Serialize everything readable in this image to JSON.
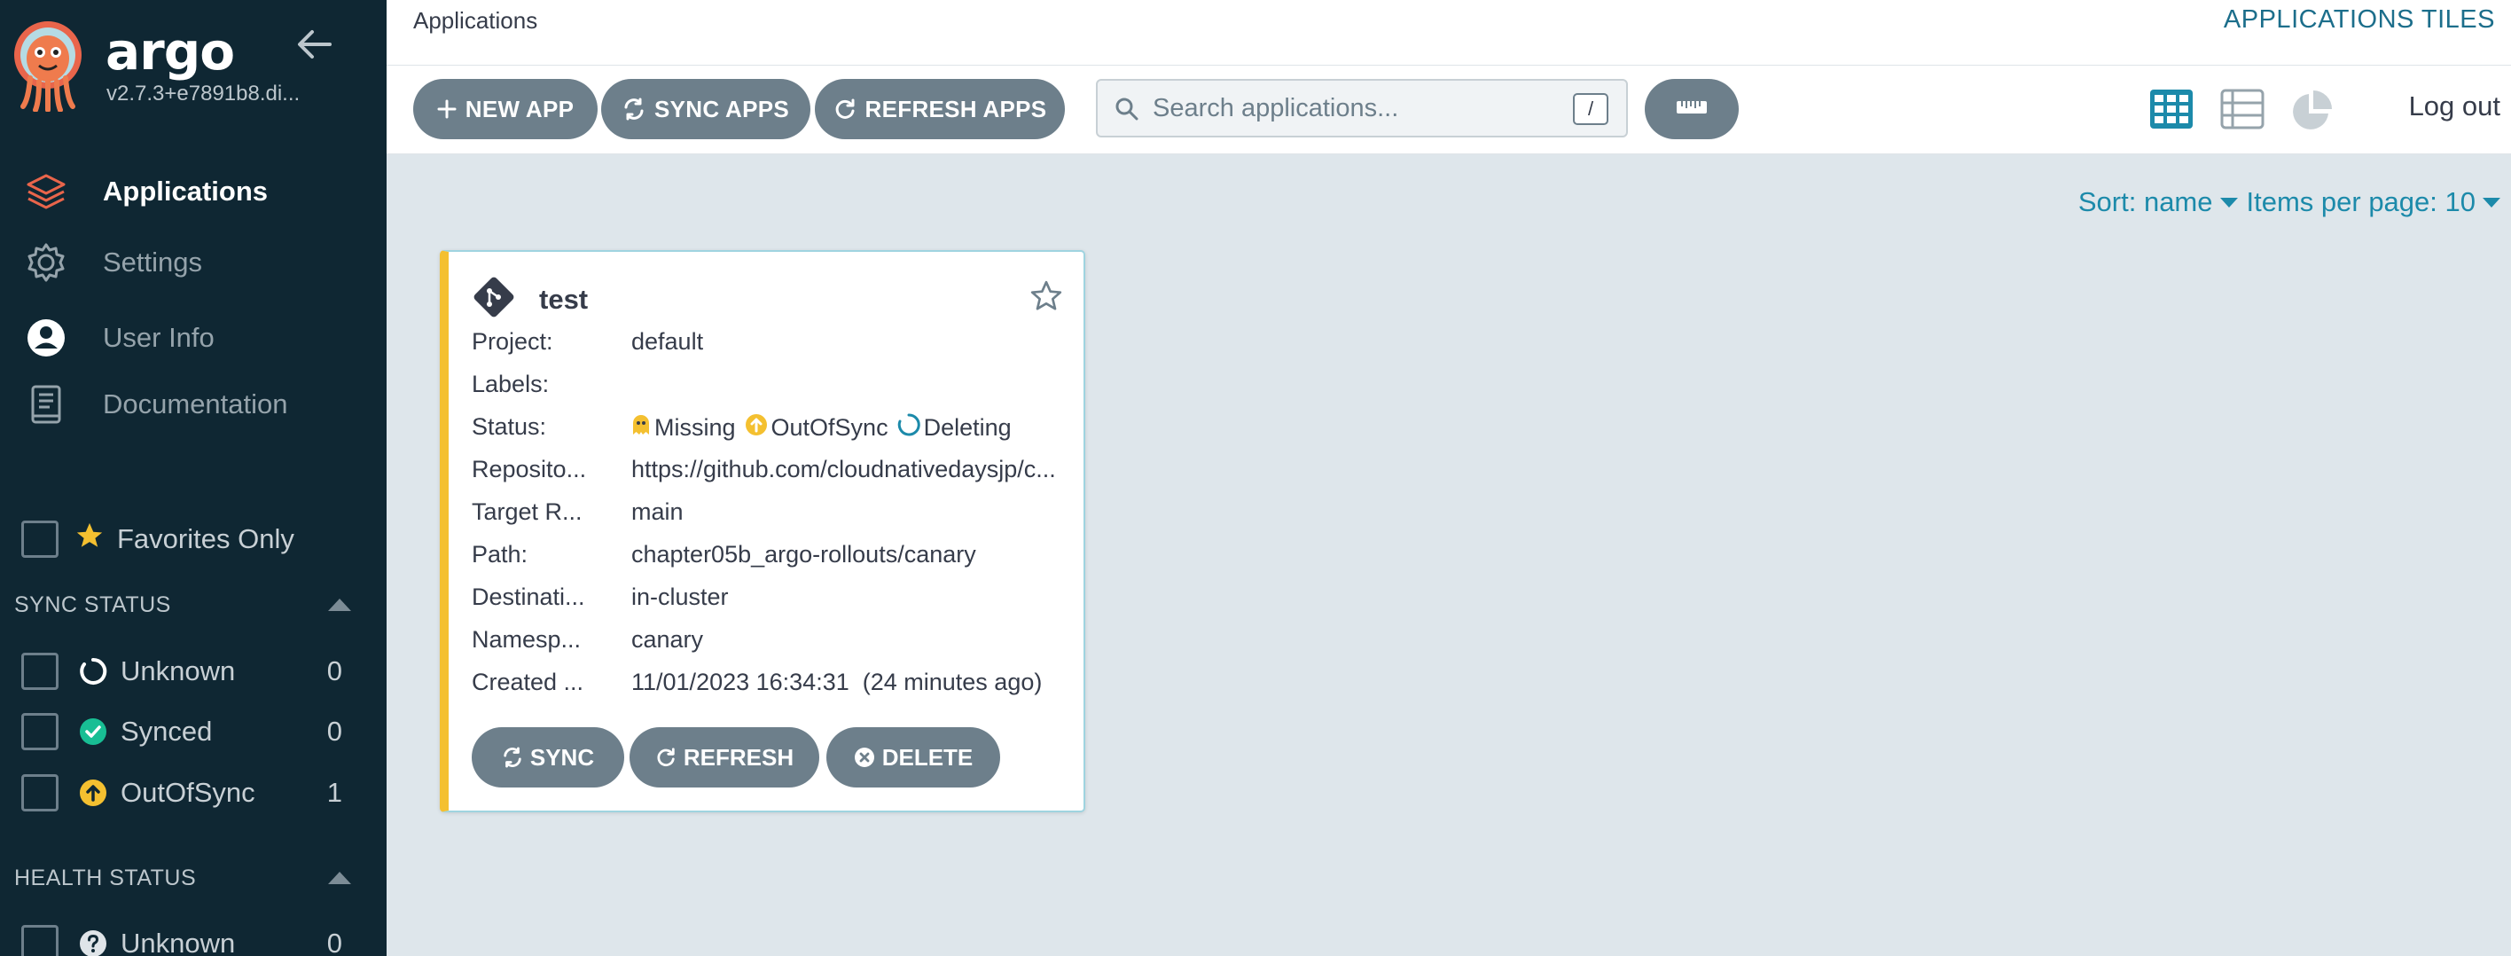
{
  "app": {
    "brand": "argo",
    "version": "v2.7.3+e7891b8.di..."
  },
  "sidebar": {
    "nav": [
      {
        "label": "Applications",
        "icon": "layers-icon"
      },
      {
        "label": "Settings",
        "icon": "gear-icon"
      },
      {
        "label": "User Info",
        "icon": "user-icon"
      },
      {
        "label": "Documentation",
        "icon": "book-icon"
      }
    ],
    "favorites_label": "Favorites Only",
    "sync_status": {
      "title": "SYNC STATUS",
      "items": [
        {
          "label": "Unknown",
          "count": "0"
        },
        {
          "label": "Synced",
          "count": "0"
        },
        {
          "label": "OutOfSync",
          "count": "1"
        }
      ]
    },
    "health_status": {
      "title": "HEALTH STATUS",
      "items": [
        {
          "label": "Unknown",
          "count": "0"
        }
      ]
    }
  },
  "topbar": {
    "breadcrumb": "Applications",
    "view_title": "APPLICATIONS TILES"
  },
  "toolbar": {
    "new_app": "NEW APP",
    "sync_apps": "SYNC APPS",
    "refresh_apps": "REFRESH APPS",
    "search_placeholder": "Search applications...",
    "search_shortcut": "/",
    "logout": "Log out"
  },
  "sort": {
    "sort_label": "Sort: name",
    "items_label": "Items per page: 10"
  },
  "card": {
    "name": "test",
    "rows": [
      {
        "key": "Project:",
        "value": "default"
      },
      {
        "key": "Labels:",
        "value": ""
      },
      {
        "key": "Status:",
        "value": ""
      },
      {
        "key": "Reposito...",
        "value": "https://github.com/cloudnativedaysjp/c..."
      },
      {
        "key": "Target R...",
        "value": "main"
      },
      {
        "key": "Path:",
        "value": "chapter05b_argo-rollouts/canary"
      },
      {
        "key": "Destinati...",
        "value": "in-cluster"
      },
      {
        "key": "Namesp...",
        "value": "canary"
      },
      {
        "key": "Created ...",
        "value": "11/01/2023 16:34:31  (24 minutes ago)"
      }
    ],
    "status": {
      "health": "Missing",
      "sync": "OutOfSync",
      "op": "Deleting"
    },
    "buttons": {
      "sync": "SYNC",
      "refresh": "REFRESH",
      "delete": "DELETE"
    }
  },
  "colors": {
    "sidebar_bg": "#0f2733",
    "accent": "#1c8aaa",
    "button": "#6d7f8b",
    "outofsync": "#f4c030",
    "synced": "#18be94"
  }
}
